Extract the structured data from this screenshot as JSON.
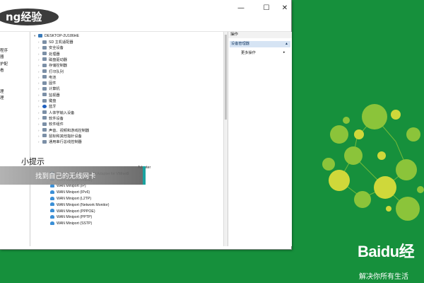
{
  "window": {
    "controls": {
      "minimize": "—",
      "maximize": "☐",
      "close": "✕"
    }
  },
  "left_pane": {
    "items": [
      "程序",
      "器",
      "护配",
      "看",
      "理",
      "理"
    ]
  },
  "tree": {
    "root": "DESKTOP-2U186HE",
    "categories": [
      {
        "label": "SD 主机适配器",
        "icon": "device-icon"
      },
      {
        "label": "安全设备",
        "icon": "device-icon"
      },
      {
        "label": "处理器",
        "icon": "device-icon"
      },
      {
        "label": "磁盘驱动器",
        "icon": "device-icon"
      },
      {
        "label": "存储控制器",
        "icon": "device-icon"
      },
      {
        "label": "打印队列",
        "icon": "device-icon"
      },
      {
        "label": "电池",
        "icon": "device-icon"
      },
      {
        "label": "固件",
        "icon": "device-icon"
      },
      {
        "label": "计算机",
        "icon": "device-icon"
      },
      {
        "label": "监视器",
        "icon": "device-icon"
      },
      {
        "label": "键盘",
        "icon": "device-icon"
      },
      {
        "label": "蓝牙",
        "icon": "bluetooth-icon"
      },
      {
        "label": "人体学输入设备",
        "icon": "device-icon"
      },
      {
        "label": "软件设备",
        "icon": "device-icon"
      },
      {
        "label": "软件组件",
        "icon": "device-icon"
      },
      {
        "label": "声音、视频和游戏控制器",
        "icon": "device-icon"
      },
      {
        "label": "鼠标和其他指针设备",
        "icon": "device-icon"
      },
      {
        "label": "通用串行总线控制器",
        "icon": "device-icon"
      }
    ],
    "network_adapters": [
      "Adapter",
      "VMware Virtual Ethernet Adapter for VMnet8",
      "WAN Miniport (IKEv2)",
      "WAN Miniport (IP)",
      "WAN Miniport (IPv6)",
      "WAN Miniport (L2TP)",
      "WAN Miniport (Network Monitor)",
      "WAN Miniport (PPPOE)",
      "WAN Miniport (PPTP)",
      "WAN Miniport (SSTP)"
    ]
  },
  "actions": {
    "header": "操作",
    "selected": "设备管理器",
    "more": "更多操作"
  },
  "tip": {
    "label": "小提示",
    "text": "找到自己的无线网卡"
  },
  "brand": {
    "top_logo": "ng经验",
    "bottom_word": "Baidu经",
    "slogan": "解决你所有生活"
  },
  "colors": {
    "background": "#1e9a44",
    "tip_accent": "#1aa3a0",
    "brain_green": "#8bc43a",
    "brain_yellow": "#cfd83a"
  }
}
